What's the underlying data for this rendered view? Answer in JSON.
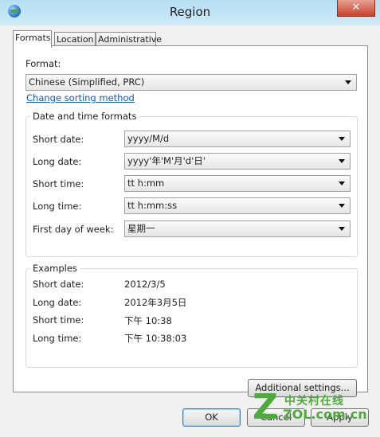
{
  "window": {
    "title": "Region",
    "close_glyph": "✕"
  },
  "tabs": [
    {
      "label": "Formats",
      "active": true
    },
    {
      "label": "Location",
      "active": false
    },
    {
      "label": "Administrative",
      "active": false
    }
  ],
  "formats": {
    "format_label": "Format:",
    "format_value": "Chinese (Simplified, PRC)",
    "sorting_link": "Change sorting method",
    "group_title": "Date and time formats",
    "fields": {
      "short_date": {
        "label": "Short date:",
        "value": "yyyy/M/d"
      },
      "long_date": {
        "label": "Long date:",
        "value": "yyyy'年'M'月'd'日'"
      },
      "short_time": {
        "label": "Short time:",
        "value": "tt h:mm"
      },
      "long_time": {
        "label": "Long time:",
        "value": "tt h:mm:ss"
      },
      "first_day": {
        "label": "First day of week:",
        "value": "星期一"
      }
    },
    "examples": {
      "title": "Examples",
      "short_date": {
        "label": "Short date:",
        "value": "2012/3/5"
      },
      "long_date": {
        "label": "Long date:",
        "value": "2012年3月5日"
      },
      "short_time": {
        "label": "Short time:",
        "value": "下午 10:38"
      },
      "long_time": {
        "label": "Long time:",
        "value": "下午 10:38:03"
      }
    },
    "additional_button": "Additional settings..."
  },
  "buttons": {
    "ok": "OK",
    "cancel": "Cancel",
    "apply": "Apply"
  },
  "watermark": {
    "mark": "Z",
    "text_cn": "中关村在线",
    "url": "ZOL.com.cn"
  },
  "colors": {
    "link": "#0f58c8",
    "titlebar": "#c8e7f6",
    "close": "#c7402a",
    "watermark": "#4eaa3c"
  }
}
